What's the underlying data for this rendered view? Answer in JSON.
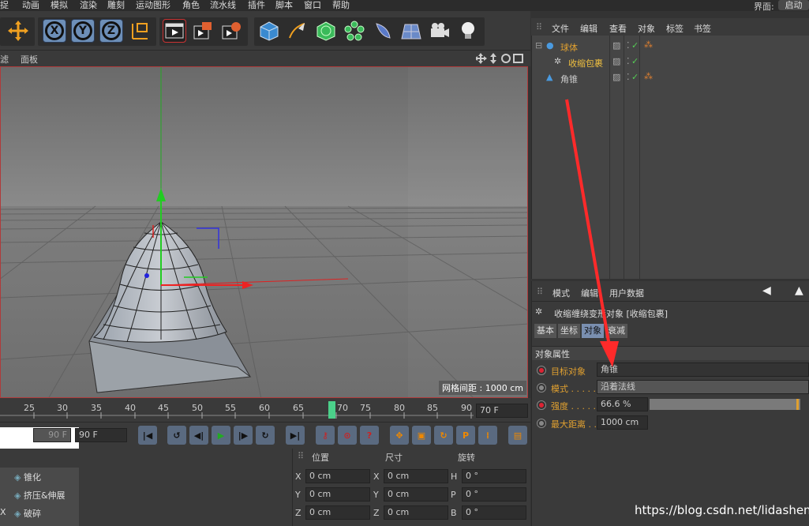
{
  "menu": {
    "items": [
      "捉",
      "动画",
      "模拟",
      "渲染",
      "雕刻",
      "运动图形",
      "角色",
      "流水线",
      "插件",
      "脚本",
      "窗口",
      "帮助"
    ],
    "ui_label": "界面:",
    "ui_value": "启动"
  },
  "toolbar": {
    "axis_labels": [
      "X",
      "Y",
      "Z"
    ]
  },
  "viewport_menu": {
    "items": [
      "滤",
      "面板"
    ]
  },
  "viewport": {
    "grid_spacing": "网格间距 : 1000 cm"
  },
  "timeline": {
    "ticks": [
      "25",
      "30",
      "35",
      "40",
      "45",
      "50",
      "55",
      "60",
      "65",
      "70",
      "75",
      "80",
      "85",
      "90"
    ],
    "current": "70",
    "end_frame": "70 F"
  },
  "time_controls": {
    "field1": "90 F",
    "field2": "90 F"
  },
  "object_list": {
    "items": [
      "锥化",
      "挤压&伸展",
      "破碎"
    ],
    "x_label": "X"
  },
  "coords": {
    "headers": [
      "位置",
      "尺寸",
      "旋转"
    ],
    "rows": [
      {
        "a": "X",
        "pos": "0 cm",
        "b": "X",
        "size": "0 cm",
        "c": "H",
        "rot": "0 °"
      },
      {
        "a": "Y",
        "pos": "0 cm",
        "b": "Y",
        "size": "0 cm",
        "c": "P",
        "rot": "0 °"
      },
      {
        "a": "Z",
        "pos": "0 cm",
        "b": "Z",
        "size": "0 cm",
        "c": "B",
        "rot": "0 °"
      }
    ]
  },
  "object_manager": {
    "menu": [
      "文件",
      "编辑",
      "查看",
      "对象",
      "标签",
      "书签"
    ],
    "tree": [
      {
        "name": "球体",
        "color": "#e0a030"
      },
      {
        "name": "收缩包裹",
        "color": "#f0c040"
      },
      {
        "name": "角锥",
        "color": "#cccccc"
      }
    ]
  },
  "attribute_manager": {
    "menu": [
      "模式",
      "编辑",
      "用户数据"
    ],
    "title": "收缩缠绕变形对象 [收缩包裹]",
    "tabs": [
      "基本",
      "坐标",
      "对象",
      "衰减"
    ],
    "section": "对象属性",
    "fields": [
      {
        "label": "目标对象",
        "value": "角锥",
        "dot": "red"
      },
      {
        "label": "模式 . . . . .",
        "value": "沿着法线",
        "dot": "gray"
      },
      {
        "label": "强度 . . . . .",
        "value": "66.6 %",
        "dot": "red",
        "fill": 0.666
      },
      {
        "label": "最大距离 . .",
        "value": "1000 cm",
        "dot": "gray"
      }
    ]
  },
  "watermark": "https://blog.csdn.net/lidashent",
  "colors": {
    "accent": "#e0a030",
    "arrow": "#ff2a2a"
  }
}
